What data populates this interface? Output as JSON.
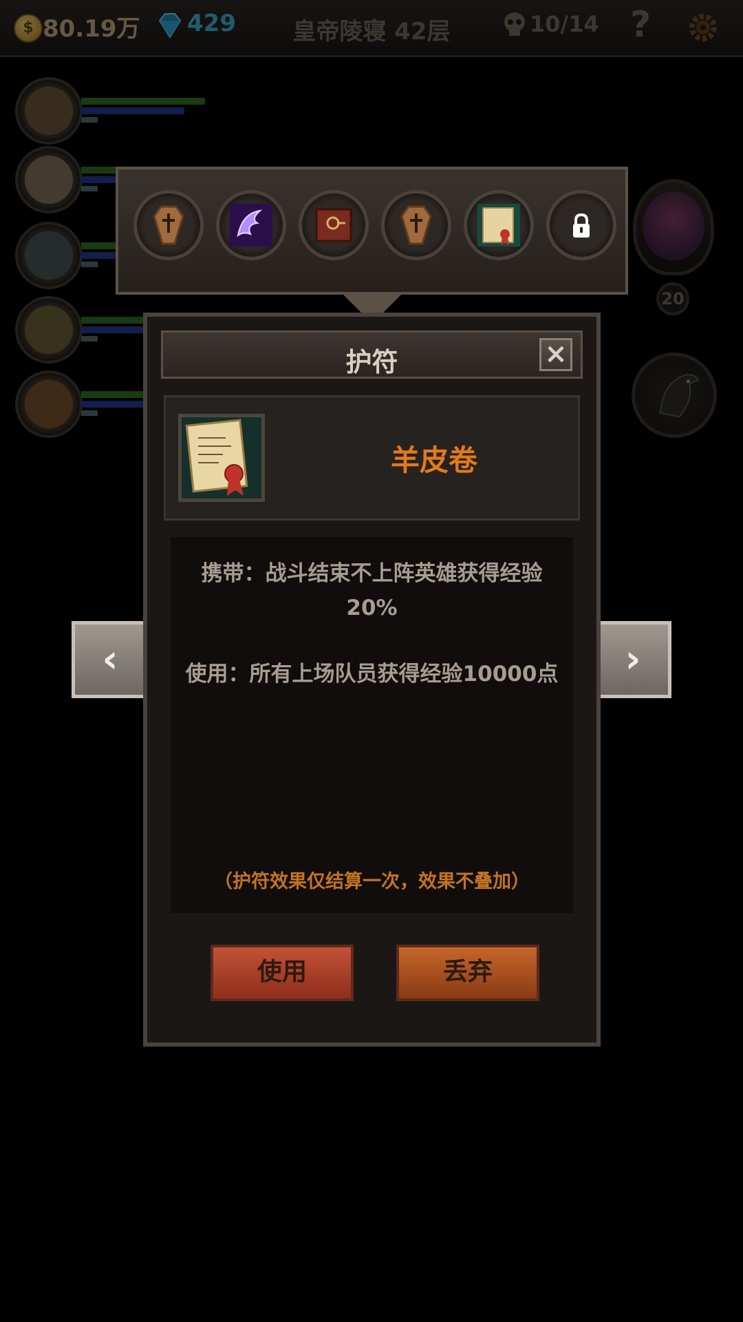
{
  "topbar": {
    "coin_symbol": "$",
    "gold": "80.19万",
    "gems": "429",
    "floor_title": "皇帝陵寝 42层",
    "kills": "10/14",
    "help": "?"
  },
  "boss": {
    "level": "20"
  },
  "amulets": [
    {
      "icon": "coffin-icon"
    },
    {
      "icon": "purple-dragon-icon"
    },
    {
      "icon": "magnifier-book-icon"
    },
    {
      "icon": "coffin-icon"
    },
    {
      "icon": "parchment-scroll-icon"
    },
    {
      "icon": "lock-icon"
    }
  ],
  "dialog": {
    "title": "护符",
    "close": "×",
    "item_name": "羊皮卷",
    "carry_effect": "携带：战斗结束不上阵英雄获得经验20%",
    "use_effect": "使用：所有上场队员获得经验10000点",
    "note": "（护符效果仅结算一次，效果不叠加）",
    "use_button": "使用",
    "discard_button": "丢弃"
  },
  "nav": {
    "prev": "‹",
    "next": "›"
  },
  "colors": {
    "item_name": "#e37a1c",
    "note": "#c47421",
    "gem": "#3ca8c8"
  }
}
